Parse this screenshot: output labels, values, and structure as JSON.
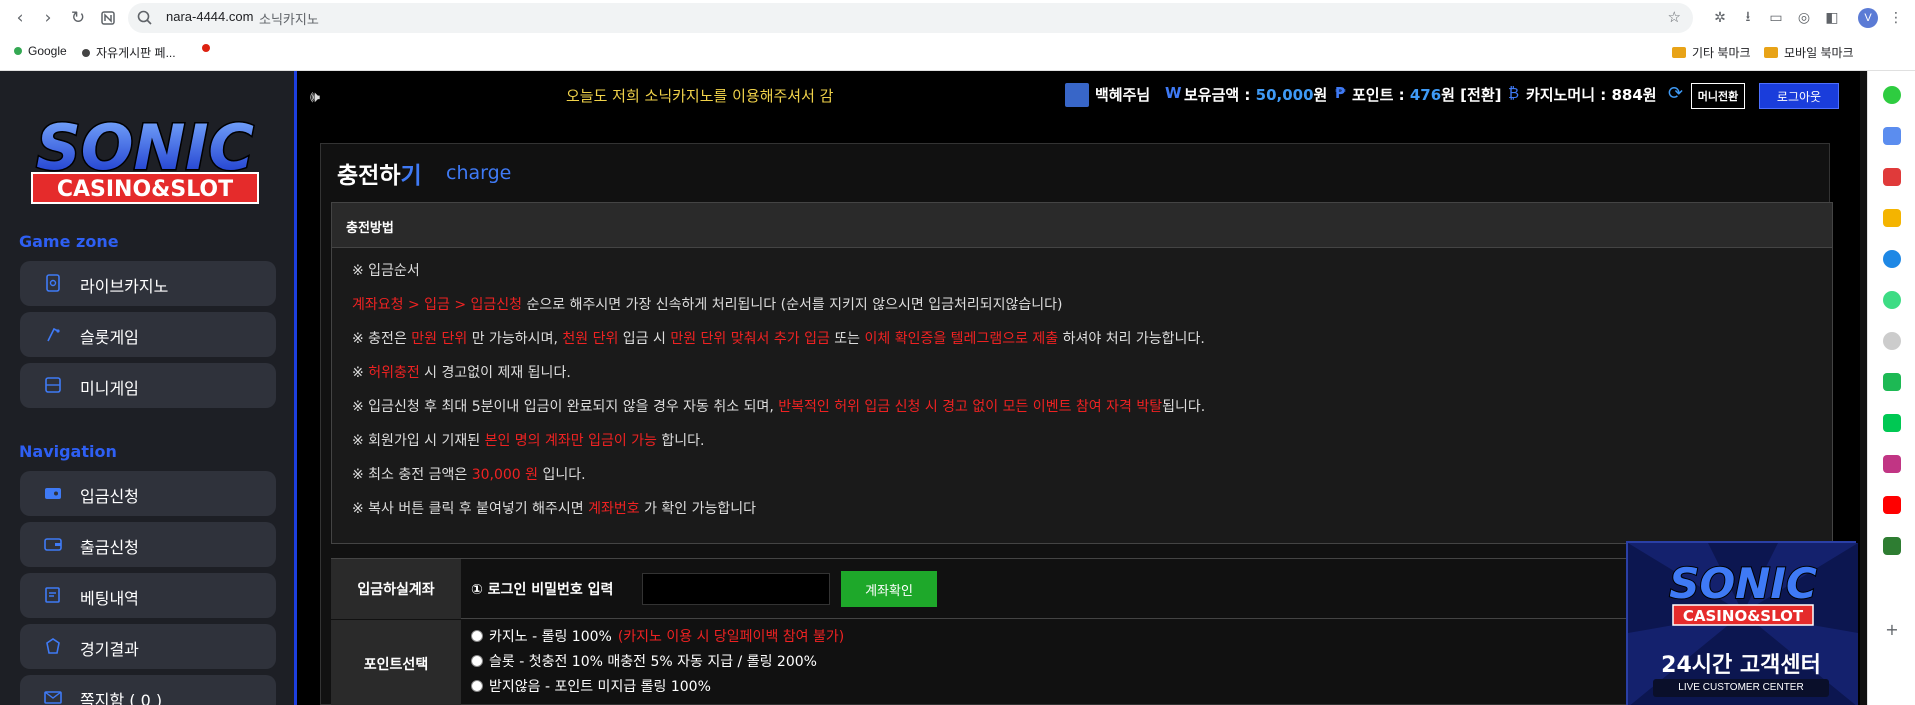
{
  "browser": {
    "url": "nara-4444.com",
    "page_title": "소닉카지노",
    "profile_initial": "V",
    "bookmarks": [
      {
        "label": "Google"
      },
      {
        "label": "자유게시판 페..."
      },
      {
        "label": ""
      }
    ],
    "bookmark_folders": [
      {
        "label": "기타 북마크"
      },
      {
        "label": "모바일 북마크"
      }
    ]
  },
  "sidebar": {
    "logo_text_main": "SONIC",
    "logo_text_sub": "CASINO&SLOT",
    "game_zone_title": "Game zone",
    "game_items": [
      {
        "label": "라이브카지노",
        "icon": "casino-icon"
      },
      {
        "label": "슬롯게임",
        "icon": "slot-icon"
      },
      {
        "label": "미니게임",
        "icon": "mini-game-icon"
      }
    ],
    "navigation_title": "Navigation",
    "nav_items": [
      {
        "label": "입금신청",
        "icon": "deposit-icon"
      },
      {
        "label": "출금신청",
        "icon": "withdraw-icon"
      },
      {
        "label": "베팅내역",
        "icon": "betting-history-icon"
      },
      {
        "label": "경기결과",
        "icon": "result-icon"
      },
      {
        "label": "쪽지함 ( 0 )",
        "icon": "message-icon"
      }
    ]
  },
  "topbar": {
    "marquee": "오늘도 저희 소닉카지노를 이용해주셔서 감",
    "username": "백혜주님",
    "balance_label": "보유금액 : ",
    "balance_value": "50,000",
    "balance_unit": "원",
    "points_label": "포인트 : ",
    "points_value": "476",
    "points_suffix": "원 [전환]",
    "casino_money": "카지노머니 : 884원",
    "money_transfer_button": "머니전환",
    "logout_button": "로그아웃"
  },
  "main": {
    "title_a": "충전하",
    "title_b": "기",
    "subtitle": "charge",
    "notice_header": "충전방법",
    "notice_lines": [
      [
        {
          "t": "※ 입금순서"
        }
      ],
      [
        {
          "t": "계좌요청 > 입금 > 입금신청",
          "r": true
        },
        {
          "t": " 순으로 해주시면 가장 신속하게 처리됩니다 (순서를 지키지 않으시면 입금처리되지않습니다)"
        }
      ],
      [
        {
          "t": "※ 충전은 "
        },
        {
          "t": "만원 단위",
          "r": true
        },
        {
          "t": " 만 가능하시며, "
        },
        {
          "t": "천원 단위",
          "r": true
        },
        {
          "t": " 입금 시 "
        },
        {
          "t": "만원 단위 맞춰서 추가 입금",
          "r": true
        },
        {
          "t": " 또는 "
        },
        {
          "t": "이체 확인증을 텔레그램으로 제출",
          "r": true
        },
        {
          "t": " 하셔야 처리 가능합니다."
        }
      ],
      [
        {
          "t": "※ "
        },
        {
          "t": "허위충전",
          "r": true
        },
        {
          "t": " 시 경고없이 제재 됩니다."
        }
      ],
      [
        {
          "t": "※ 입금신청 후 최대 5분이내 입금이 완료되지 않을 경우 자동 취소 되며, "
        },
        {
          "t": "반복적인 허위 입금 신청 시 경고 없이 모든 이벤트 참여 자격 박탈",
          "r": true
        },
        {
          "t": "됩니다."
        }
      ],
      [
        {
          "t": "※ 회원가입 시 기재된 "
        },
        {
          "t": "본인 명의 계좌만 입금이 가능",
          "r": true
        },
        {
          "t": " 합니다."
        }
      ],
      [
        {
          "t": "※ 최소 충전 금액은 "
        },
        {
          "t": "30,000 원",
          "r": true
        },
        {
          "t": " 입니다."
        }
      ],
      [
        {
          "t": "※ 복사 버튼 클릭 후 붙여넣기 해주시면 "
        },
        {
          "t": "계좌번호",
          "r": true
        },
        {
          "t": " 가 확인 가능합니다"
        }
      ]
    ],
    "account_label": "입금하실계좌",
    "password_label": "① 로그인 비밀번호 입력",
    "password_value": "",
    "check_button": "계좌확인",
    "point_label": "포인트선택",
    "point_options": [
      {
        "text": "카지노 - 롤링 100% ",
        "red": "(카지노 이용 시 당일페이백 참여 불가)"
      },
      {
        "text": "슬롯 - 첫충전 10% 매충전 5% 자동 지급 / 롤링 200%",
        "red": ""
      },
      {
        "text": "받지않음 - 포인트 미지급 롤링 100%",
        "red": ""
      }
    ]
  },
  "promo": {
    "logo_main": "SONIC",
    "logo_sub": "CASINO&SLOT",
    "headline": "24시간 고객센터",
    "caption": "LIVE CUSTOMER CENTER"
  },
  "colors": {
    "accent_blue": "#1d3fe0",
    "highlight_red": "#e22222",
    "marquee_yellow": "#f0d24a",
    "confirm_green": "#1ea82a"
  }
}
